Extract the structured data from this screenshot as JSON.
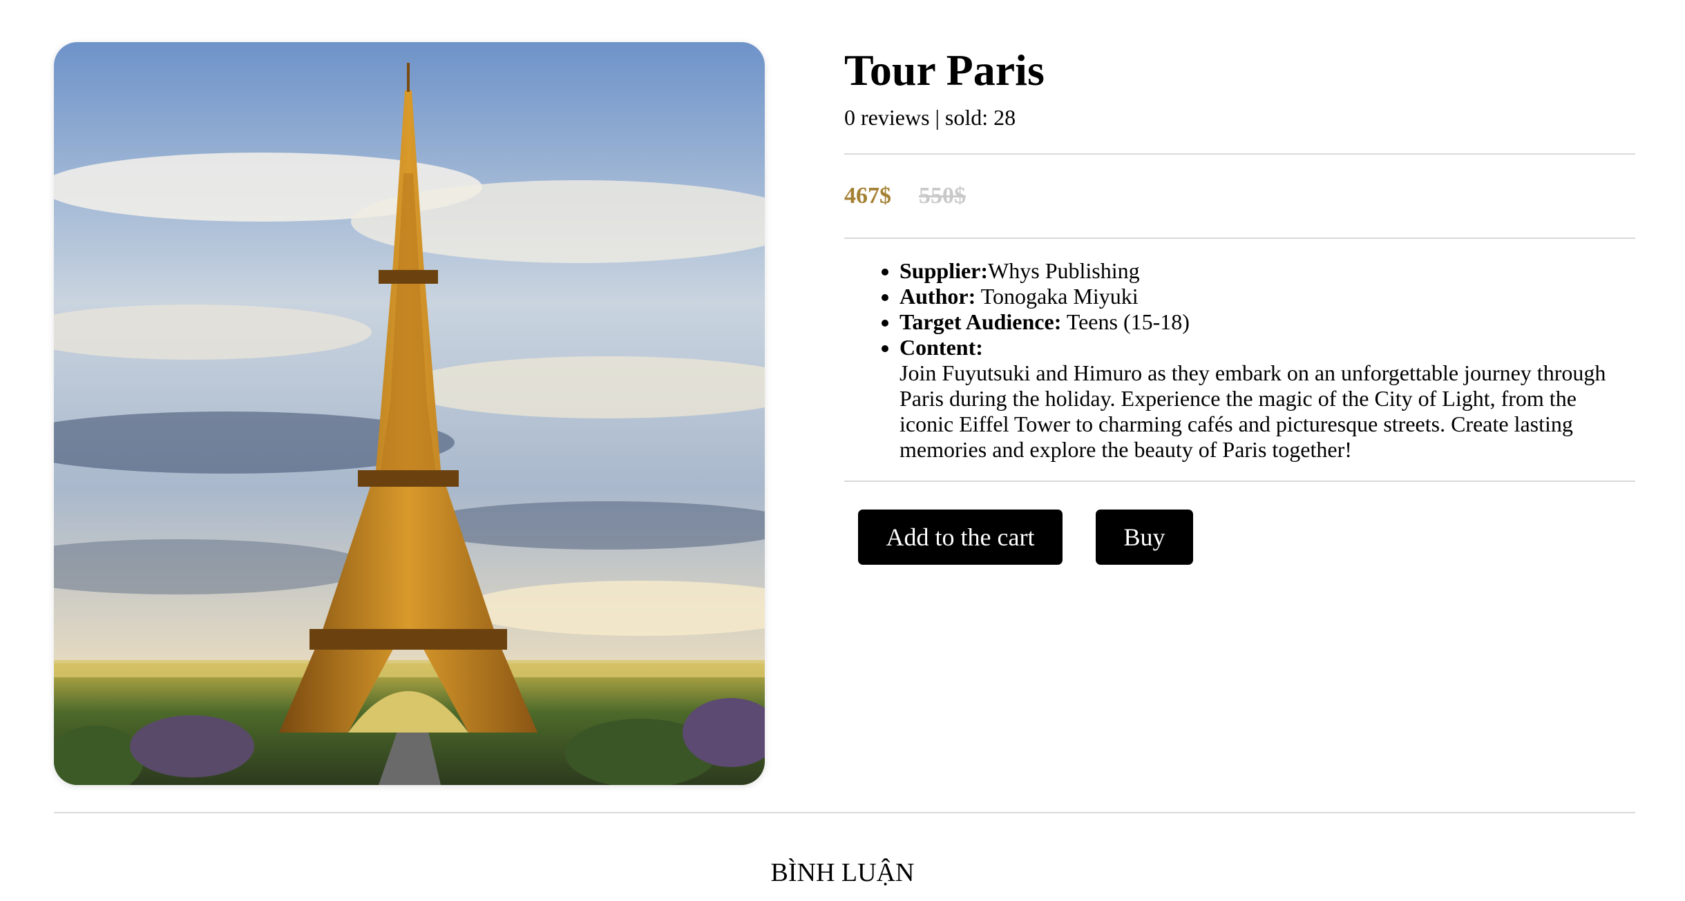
{
  "product": {
    "title": "Tour Paris",
    "reviews": "0 reviews",
    "separator": "|",
    "sold": "sold: 28",
    "price_current": "467$",
    "price_old": "550$",
    "image_icon": "eiffel-tower-photo"
  },
  "details": {
    "supplier_label": "Supplier:",
    "supplier_value": "Whys Publishing",
    "author_label": "Author:",
    "author_value": "Tonogaka Miyuki",
    "audience_label": "Target Audience:",
    "audience_value": "Teens (15-18)",
    "content_label": "Content:",
    "content_value": "Join Fuyutsuki and Himuro as they embark on an unforgettable journey through Paris during the holiday. Experience the magic of the City of Light, from the iconic Eiffel Tower to charming cafés and picturesque streets. Create lasting memories and explore the beauty of Paris together!"
  },
  "actions": {
    "add_to_cart": "Add to the cart",
    "buy": "Buy"
  },
  "comments": {
    "heading": "BÌNH LUẬN"
  },
  "colors": {
    "price_current": "#a58135",
    "price_old": "#c9c9c9",
    "button_bg": "#000000",
    "button_text": "#ffffff",
    "divider": "#d9d9d9"
  }
}
